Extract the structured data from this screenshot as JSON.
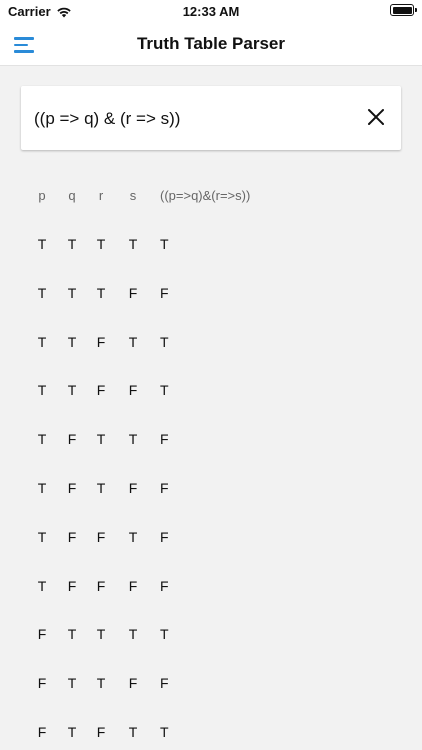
{
  "status_bar": {
    "carrier": "Carrier",
    "time": "12:33 AM",
    "battery_level": 1.0
  },
  "nav": {
    "title": "Truth Table Parser",
    "menu_icon": "hamburger-menu-icon",
    "accent_color": "#2a8bd8"
  },
  "expression": {
    "value": "((p => q) & (r => s))",
    "clear_icon": "close-icon"
  },
  "table": {
    "headers": [
      "p",
      "q",
      "r",
      "s",
      "((p=>q)&(r=>s))"
    ],
    "rows": [
      [
        "T",
        "T",
        "T",
        "T",
        "T"
      ],
      [
        "T",
        "T",
        "T",
        "F",
        "F"
      ],
      [
        "T",
        "T",
        "F",
        "T",
        "T"
      ],
      [
        "T",
        "T",
        "F",
        "F",
        "T"
      ],
      [
        "T",
        "F",
        "T",
        "T",
        "F"
      ],
      [
        "T",
        "F",
        "T",
        "F",
        "F"
      ],
      [
        "T",
        "F",
        "F",
        "T",
        "F"
      ],
      [
        "T",
        "F",
        "F",
        "F",
        "F"
      ],
      [
        "F",
        "T",
        "T",
        "T",
        "T"
      ],
      [
        "F",
        "T",
        "T",
        "F",
        "F"
      ],
      [
        "F",
        "T",
        "F",
        "T",
        "T"
      ]
    ]
  }
}
